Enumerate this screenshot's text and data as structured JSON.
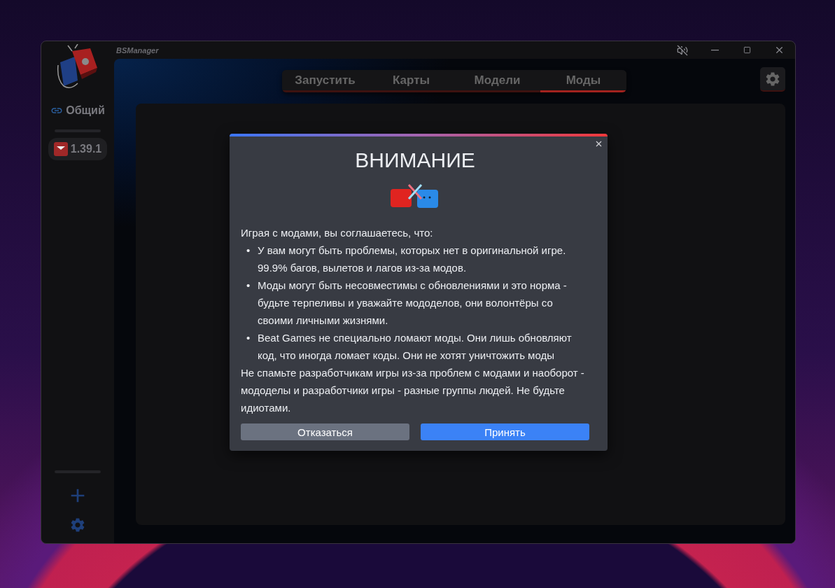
{
  "window": {
    "title": "BSManager"
  },
  "sidebar": {
    "items": [
      {
        "kind": "shared",
        "label": "Общий",
        "selected": false
      },
      {
        "kind": "version",
        "label": "1.39.1",
        "selected": true
      }
    ]
  },
  "tabs": [
    {
      "label": "Запустить",
      "selected": false
    },
    {
      "label": "Карты",
      "selected": false
    },
    {
      "label": "Модели",
      "selected": false
    },
    {
      "label": "Моды",
      "selected": true
    }
  ],
  "modal": {
    "title": "ВНИМАНИЕ",
    "intro": "Играя с модами, вы соглашаетесь, что:",
    "bullets": [
      {
        "marker": "•",
        "text": "У вам могут быть проблемы, которых нет в оригинальной игре. 99.9% багов, вылетов и лагов из-за модов."
      },
      {
        "marker": "•",
        "text": "Моды могут быть несовместимы с обновлениями и это норма - будьте терпеливы и уважайте мододелов, они волонтёры со своими личными жизнями."
      },
      {
        "marker": "•",
        "text": "Beat Games не специально ломают моды. Они лишь обновляют код, что иногда ломает коды. Они не хотят уничтожить моды"
      }
    ],
    "outro": "Не спамьте разработчикам игры из-за проблем с модами и наоборот - мододелы и разработчики игры - разные группы людей. Не будьте идиотами.",
    "buttons": [
      {
        "kind": "secondary",
        "label": "Отказаться"
      },
      {
        "kind": "primary",
        "label": "Принять"
      }
    ]
  }
}
